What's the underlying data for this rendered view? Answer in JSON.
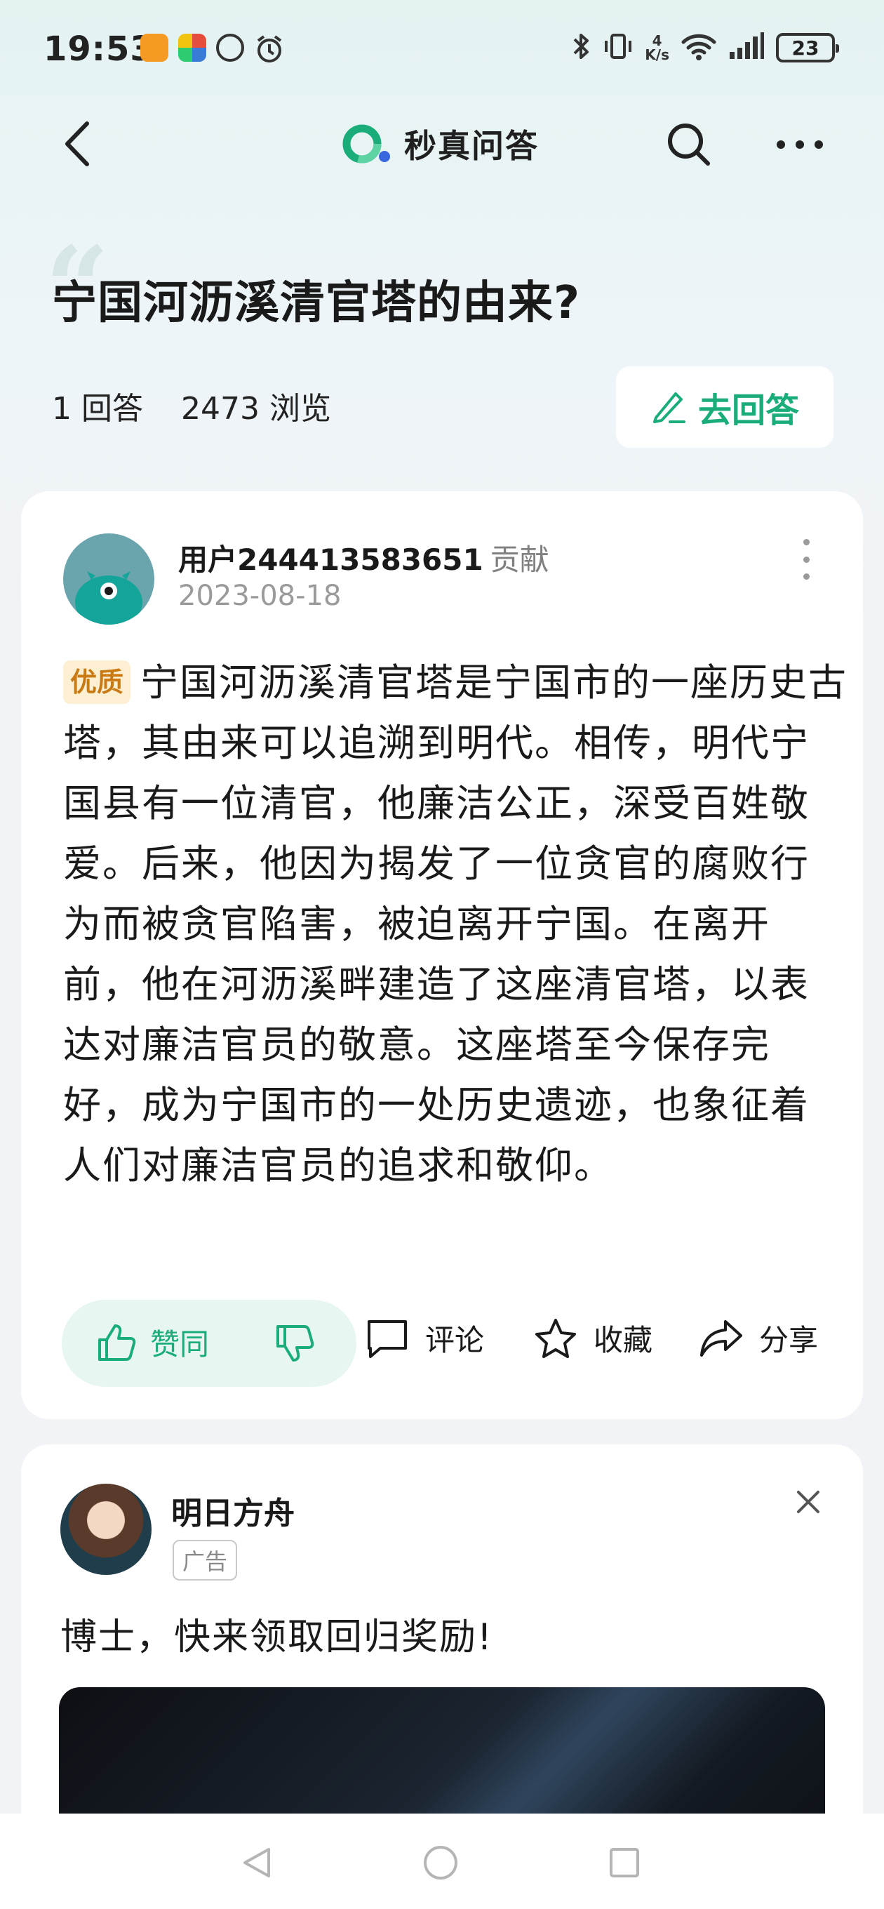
{
  "status_bar": {
    "time": "19:53",
    "net_speed_value": "4",
    "net_speed_unit": "K/s",
    "battery": "23",
    "icons": [
      "app-notification-icon",
      "app-notification-icon",
      "app-notification-icon",
      "alarm-icon",
      "bluetooth-icon",
      "vibrate-icon",
      "wifi-icon",
      "signal-icon",
      "battery-icon"
    ]
  },
  "nav": {
    "brand_title": "秒真问答",
    "brand_color": "#1aad79"
  },
  "question": {
    "title": "宁国河沥溪清官塔的由来?",
    "answers_count": "1 回答",
    "views_count": "2473 浏览",
    "answer_button_label": "去回答"
  },
  "answer": {
    "author": "用户244413583651",
    "author_role": "贡献",
    "date": "2023-08-18",
    "badge": "优质",
    "body": "宁国河沥溪清官塔是宁国市的一座历史古塔，其由来可以追溯到明代。相传，明代宁国县有一位清官，他廉洁公正，深受百姓敬爱。后来，他因为揭发了一位贪官的腐败行为而被贪官陷害，被迫离开宁国。在离开前，他在河沥溪畔建造了这座清官塔，以表达对廉洁官员的敬意。这座塔至今保存完好，成为宁国市的一处历史遗迹，也象征着人们对廉洁官员的追求和敬仰。",
    "actions": {
      "upvote": "赞同",
      "comment": "评论",
      "favorite": "收藏",
      "share": "分享"
    }
  },
  "ad": {
    "name": "明日方舟",
    "tag": "广告",
    "text": "博士，快来领取回归奖励!"
  },
  "colors": {
    "accent": "#1aad79",
    "badge_bg": "#fdf0d2",
    "badge_text": "#c97a13"
  }
}
